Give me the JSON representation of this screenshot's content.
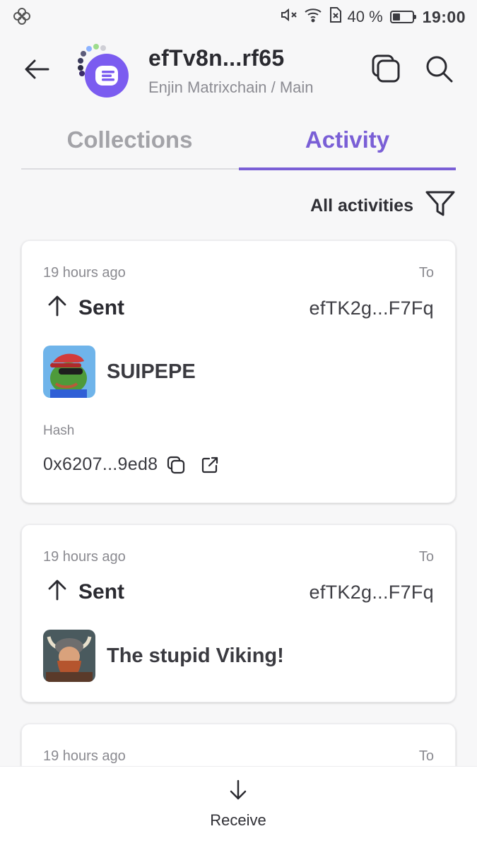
{
  "status_bar": {
    "battery_percent": "40 %",
    "battery_level": 0.4,
    "time": "19:00",
    "icons": [
      "pinwheel-icon",
      "mute-icon",
      "wifi-icon",
      "sim-icon",
      "battery-icon"
    ]
  },
  "header": {
    "account_name": "efTv8n...rf65",
    "network": "Enjin Matrixchain / Main",
    "icons": [
      "back-arrow-icon",
      "copy-icon",
      "search-icon"
    ],
    "accent_color": "#7b5cf0"
  },
  "tabs": [
    {
      "label": "Collections",
      "active": false
    },
    {
      "label": "Activity",
      "active": true
    }
  ],
  "filter": {
    "label": "All activities"
  },
  "activities": [
    {
      "time": "19 hours ago",
      "to_label": "To",
      "direction": "Sent",
      "to_address": "efTK2g...F7Fq",
      "token_name": "SUIPEPE",
      "hash_label": "Hash",
      "hash": "0x6207...9ed8"
    },
    {
      "time": "19 hours ago",
      "to_label": "To",
      "direction": "Sent",
      "to_address": "efTK2g...F7Fq",
      "token_name": "The stupid Viking!"
    },
    {
      "time": "19 hours ago",
      "to_label": "To"
    }
  ],
  "bottom": {
    "receive_label": "Receive"
  }
}
